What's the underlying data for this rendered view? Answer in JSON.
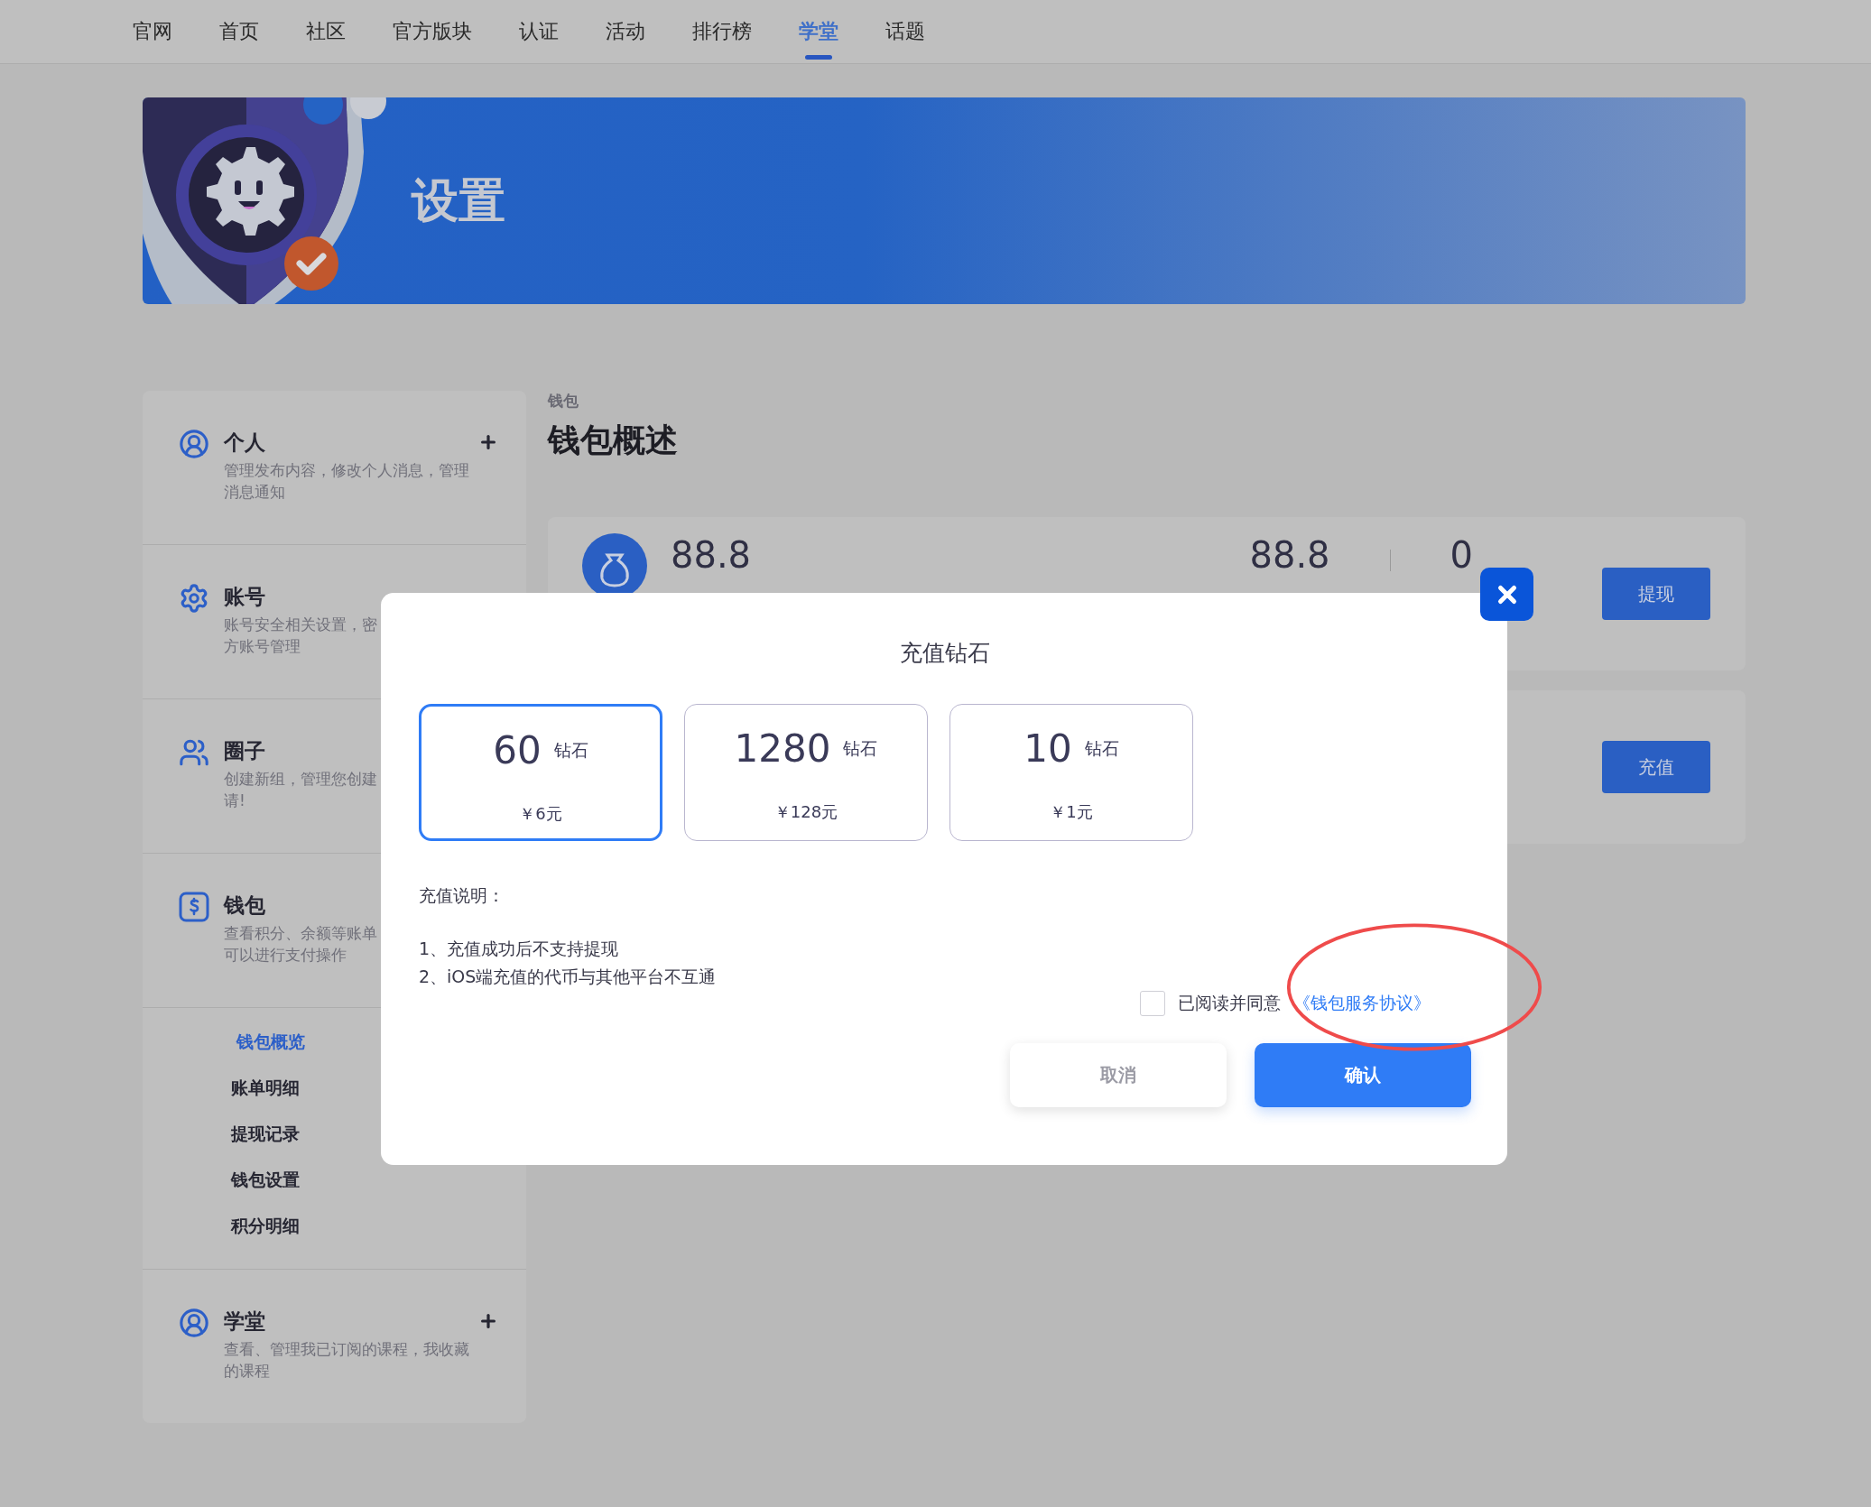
{
  "nav": [
    {
      "label": "官网",
      "selected": false
    },
    {
      "label": "首页",
      "selected": false
    },
    {
      "label": "社区",
      "selected": false
    },
    {
      "label": "官方版块",
      "selected": false
    },
    {
      "label": "认证",
      "selected": false
    },
    {
      "label": "活动",
      "selected": false
    },
    {
      "label": "排行榜",
      "selected": false
    },
    {
      "label": "学堂",
      "selected": true
    },
    {
      "label": "话题",
      "selected": false
    }
  ],
  "banner": {
    "title": "设置"
  },
  "sidebar": {
    "sections": [
      {
        "title": "个人",
        "kind": "user",
        "lines": [
          "管理发布内容，修改个人消息，管理",
          "消息通知"
        ],
        "expandable": true
      },
      {
        "title": "账号",
        "kind": "gear",
        "lines": [
          "账号安全相关设置，密",
          "方账号管理"
        ],
        "expandable": false
      },
      {
        "title": "圈子",
        "kind": "group",
        "lines": [
          "创建新组，管理您创建",
          "请!"
        ],
        "expandable": false
      },
      {
        "title": "钱包",
        "kind": "wallet",
        "lines": [
          "查看积分、余额等账单",
          "可以进行支付操作"
        ],
        "expandable": false,
        "children": [
          {
            "label": "钱包概览",
            "selected": true
          },
          {
            "label": "账单明细",
            "selected": false
          },
          {
            "label": "提现记录",
            "selected": false
          },
          {
            "label": "钱包设置",
            "selected": false
          },
          {
            "label": "积分明细",
            "selected": false
          }
        ]
      },
      {
        "title": "学堂",
        "kind": "user",
        "lines": [
          "查看、管理我已订阅的课程，我收藏",
          "的课程"
        ],
        "expandable": true
      }
    ]
  },
  "content": {
    "breadcrumb": "钱包",
    "title": "钱包概述",
    "cards": [
      {
        "amount": "88.8",
        "stats": [
          "88.8",
          "0"
        ],
        "button": "提现"
      },
      {
        "button": "充值"
      }
    ]
  },
  "modal": {
    "title": "充值钻石",
    "options": [
      {
        "amount": "60",
        "unit": "钻石",
        "price": "￥6元",
        "selected": true
      },
      {
        "amount": "1280",
        "unit": "钻石",
        "price": "￥128元",
        "selected": false
      },
      {
        "amount": "10",
        "unit": "钻石",
        "price": "￥1元",
        "selected": false
      }
    ],
    "notes_title": "充值说明：",
    "notes": [
      "1、充值成功后不支持提现",
      "2、iOS端充值的代币与其他平台不互通"
    ],
    "agreement": {
      "checked": false,
      "text": "已阅读并同意",
      "link": "《钱包服务协议》"
    },
    "buttons": [
      {
        "label": "取消",
        "kind": "secondary"
      },
      {
        "label": "确认",
        "kind": "primary"
      }
    ]
  }
}
